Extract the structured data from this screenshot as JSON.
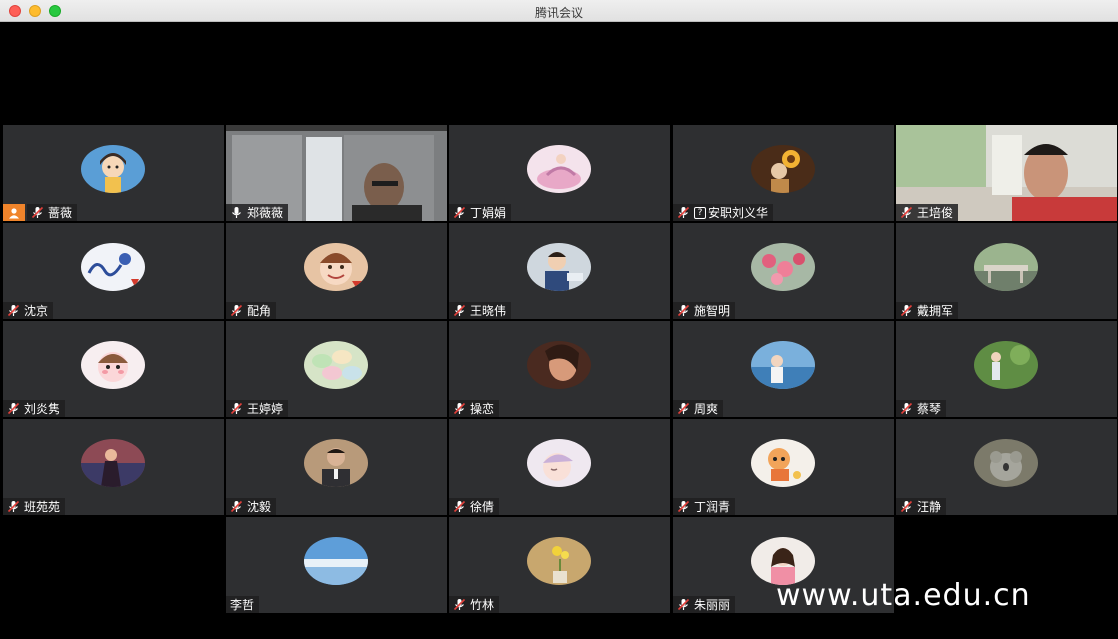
{
  "window": {
    "title": "腾讯会议"
  },
  "participants": [
    {
      "name": "蔷薇",
      "host": true,
      "video": false,
      "avatar": "cartoon-girl"
    },
    {
      "name": "郑薇薇",
      "video": true,
      "active": true
    },
    {
      "name": "丁娟娟",
      "video": false,
      "avatar": "dancer"
    },
    {
      "name": "安职刘义华",
      "prefix": "?",
      "video": false,
      "avatar": "sunflower"
    },
    {
      "name": "王培俊",
      "video": true
    },
    {
      "name": "沈京",
      "video": false,
      "avatar": "blue-sketch"
    },
    {
      "name": "配角",
      "video": false,
      "avatar": "smiling-child"
    },
    {
      "name": "王晓伟",
      "video": false,
      "avatar": "boy"
    },
    {
      "name": "施智明",
      "video": false,
      "avatar": "pink-flowers"
    },
    {
      "name": "戴拥军",
      "video": false,
      "avatar": "bridge"
    },
    {
      "name": "刘炎隽",
      "video": false,
      "avatar": "cartoon-pink"
    },
    {
      "name": "王婷婷",
      "video": false,
      "avatar": "macarons"
    },
    {
      "name": "操恋",
      "video": false,
      "avatar": "portrait-warm"
    },
    {
      "name": "周爽",
      "video": false,
      "avatar": "seaside"
    },
    {
      "name": "蔡琴",
      "video": false,
      "avatar": "garden"
    },
    {
      "name": "班苑苑",
      "video": false,
      "avatar": "woman-sunset"
    },
    {
      "name": "沈毅",
      "video": false,
      "avatar": "man-portrait"
    },
    {
      "name": "徐倩",
      "video": false,
      "avatar": "cartoon-sleep"
    },
    {
      "name": "丁润青",
      "video": false,
      "avatar": "cartoon-cat"
    },
    {
      "name": "汪静",
      "video": false,
      "avatar": "koala"
    },
    {
      "name": "李哲",
      "video": false,
      "no_mic": true,
      "avatar": "sky"
    },
    {
      "name": "竹林",
      "video": false,
      "avatar": "yellow-flower"
    },
    {
      "name": "朱丽丽",
      "video": false,
      "avatar": "woman-pink"
    }
  ],
  "watermark": "www.uta.edu.cn"
}
